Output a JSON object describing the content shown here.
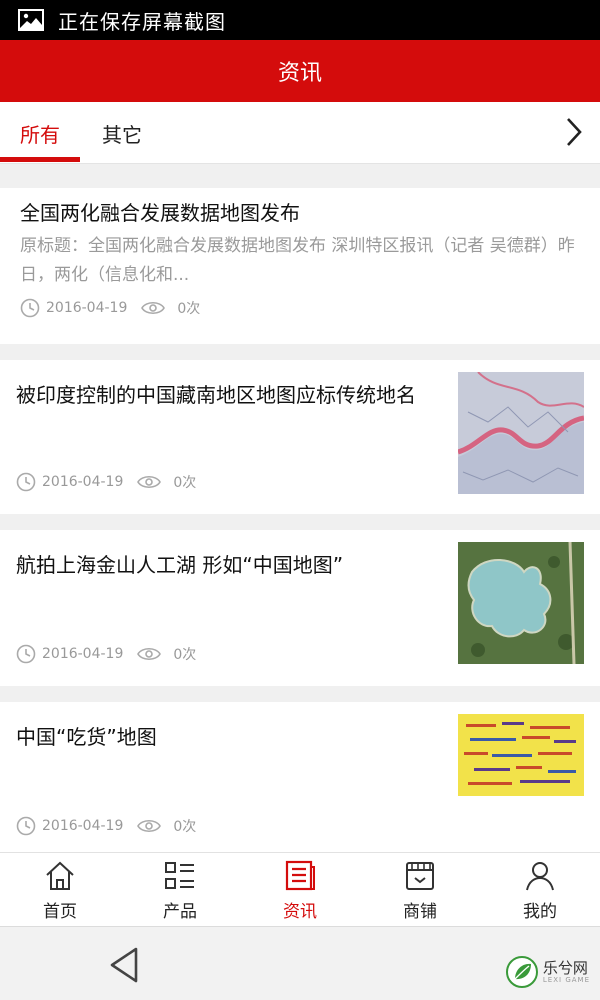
{
  "status_bar": {
    "text": "正在保存屏幕截图"
  },
  "header": {
    "title": "资讯"
  },
  "tabs": [
    {
      "label": "所有",
      "active": true
    },
    {
      "label": "其它",
      "active": false
    }
  ],
  "news": [
    {
      "title": "全国两化融合发展数据地图发布",
      "summary": "原标题：全国两化融合发展数据地图发布 深圳特区报讯（记者 吴德群）昨日，两化（信息化和...",
      "date": "2016-04-19",
      "views": "0次"
    },
    {
      "title": "被印度控制的中国藏南地区地图应标传统地名",
      "date": "2016-04-19",
      "views": "0次",
      "thumb": "map-image"
    },
    {
      "title": "航拍上海金山人工湖 形如“中国地图”",
      "date": "2016-04-19",
      "views": "0次",
      "thumb": "aerial-lake-image"
    },
    {
      "title": "中国“吃货”地图",
      "date": "2016-04-19",
      "views": "0次",
      "thumb": "food-map-image"
    }
  ],
  "bottom_nav": [
    {
      "label": "首页",
      "icon": "home-icon",
      "active": false
    },
    {
      "label": "产品",
      "icon": "product-grid-icon",
      "active": false
    },
    {
      "label": "资讯",
      "icon": "news-icon",
      "active": true
    },
    {
      "label": "商铺",
      "icon": "shop-icon",
      "active": false
    },
    {
      "label": "我的",
      "icon": "user-icon",
      "active": false
    }
  ],
  "watermark": {
    "text": "乐兮网",
    "sub": "LEXI GAME"
  },
  "colors": {
    "brand": "#d40c0c",
    "muted": "#999999"
  }
}
